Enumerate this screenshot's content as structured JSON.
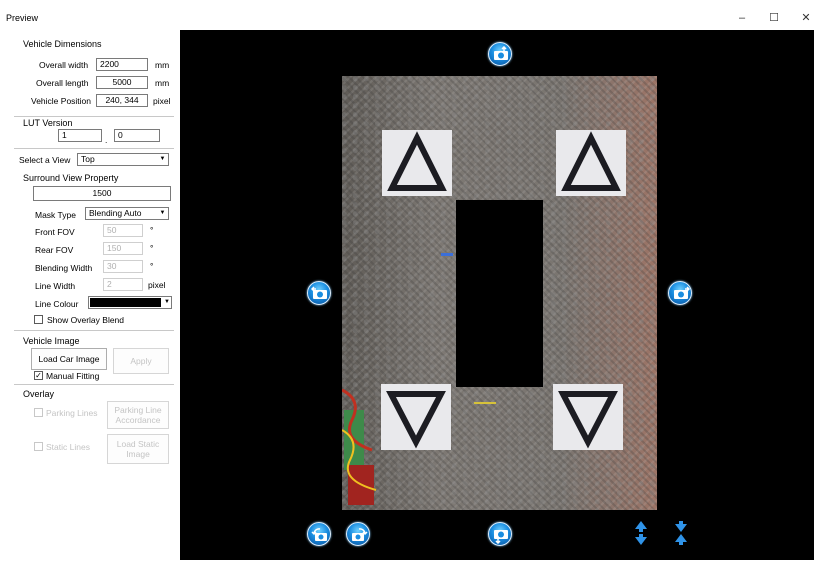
{
  "window": {
    "title": "Preview",
    "minimize": "–",
    "maximize": "☐",
    "close": "✕"
  },
  "vehicle_dimensions": {
    "title": "Vehicle Dimensions",
    "overall_width_label": "Overall width",
    "overall_width_value": "2200",
    "overall_width_unit": "mm",
    "overall_length_label": "Overall length",
    "overall_length_value": "5000",
    "overall_length_unit": "mm",
    "vehicle_position_label": "Vehicle Position",
    "vehicle_position_value": "240, 344",
    "vehicle_position_unit": "pixel"
  },
  "lut_version": {
    "title": "LUT Version",
    "major": "1",
    "separator": ".",
    "minor": "0"
  },
  "select_view": {
    "label": "Select a View",
    "value": "Top"
  },
  "surround_view": {
    "title": "Surround View Property",
    "value": "1500",
    "mask_type_label": "Mask Type",
    "mask_type_value": "Blending Auto",
    "front_fov_label": "Front FOV",
    "front_fov_value": "50",
    "front_fov_unit": "°",
    "rear_fov_label": "Rear FOV",
    "rear_fov_value": "150",
    "rear_fov_unit": "°",
    "blending_width_label": "Blending Width",
    "blending_width_value": "30",
    "blending_width_unit": "°",
    "line_width_label": "Line Width",
    "line_width_value": "2",
    "line_width_unit": "pixel",
    "line_colour_label": "Line Colour",
    "line_colour_value": "#000000",
    "show_overlay_label": "Show Overlay Blend",
    "show_overlay_checked": false
  },
  "vehicle_image": {
    "title": "Vehicle Image",
    "load_button": "Load Car Image",
    "apply_button": "Apply",
    "manual_fitting_label": "Manual Fitting",
    "manual_fitting_checked": true
  },
  "overlay": {
    "title": "Overlay",
    "parking_lines_label": "Parking Lines",
    "parking_lines_button": "Parking Line Accordance",
    "static_lines_label": "Static Lines",
    "load_static_button": "Load Static Image"
  },
  "colors": {
    "preview_bg": "#000000",
    "button_blue": "#1a8de0",
    "marker_paper": "#e9e9ec",
    "marker_line": "#1c1c22"
  },
  "icons": {
    "top_camera": "camera-top-icon",
    "left_camera": "camera-left-icon",
    "right_camera": "camera-right-icon",
    "rotate_left": "rotate-left-icon",
    "rotate_right": "rotate-right-icon",
    "bottom_camera": "camera-bottom-icon",
    "expand_vertical": "expand-vertical-icon",
    "shrink_vertical": "shrink-vertical-icon"
  }
}
